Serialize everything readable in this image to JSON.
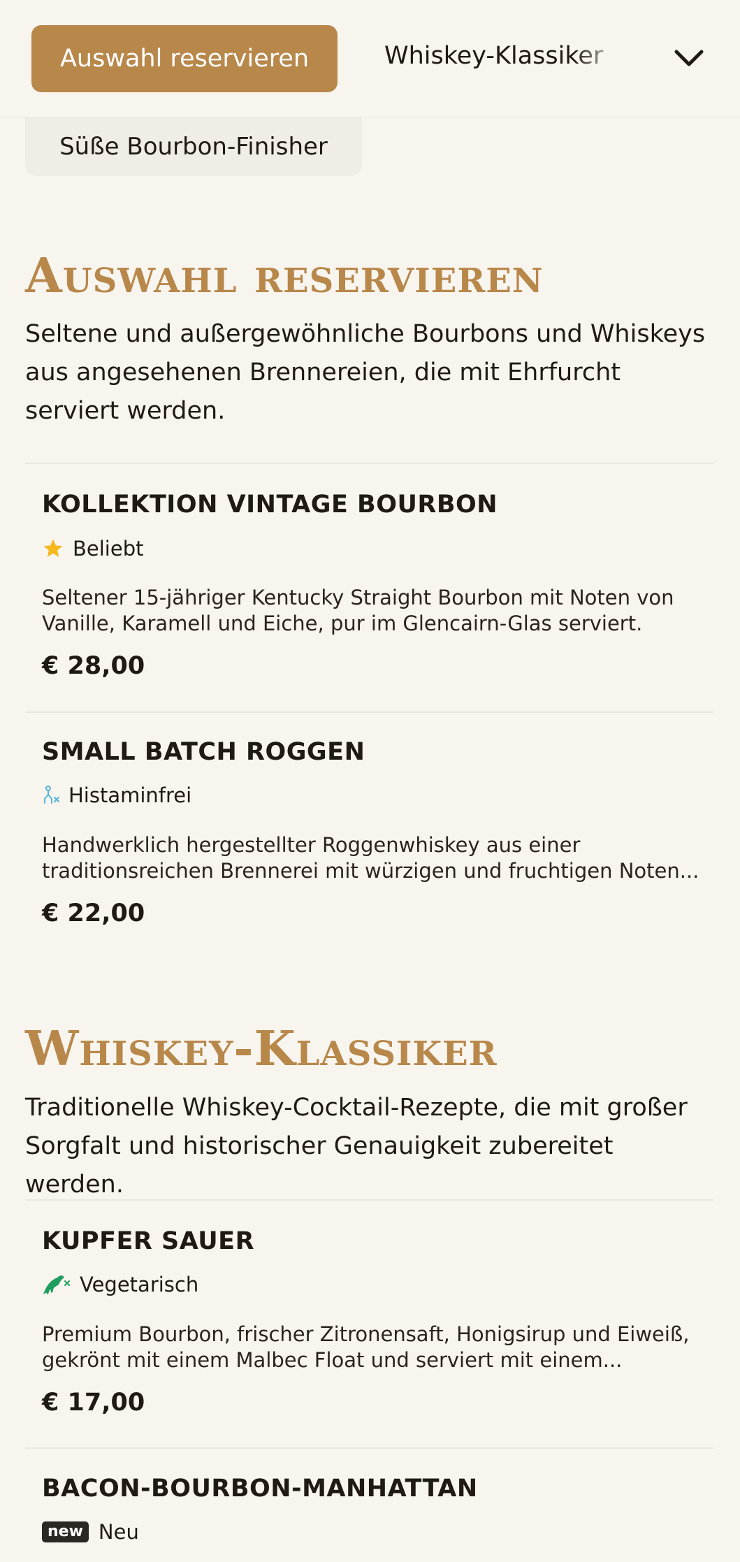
{
  "nav": {
    "active_tab": "Auswahl reservieren",
    "next_tab": "Whiskey-Klassiker",
    "previous_chip": "Süße Bourbon-Finisher",
    "dropdown_icon": "chevron-down-icon"
  },
  "sections": [
    {
      "title": "Auswahl reservieren",
      "description": "Seltene und außergewöhnliche Bourbons und Whiskeys aus angesehenen Brennereien, die mit Ehrfurcht serviert werden.",
      "items": [
        {
          "name": "KOLLEKTION VINTAGE BOURBON",
          "tag": "Beliebt",
          "tag_icon": "star-icon",
          "desc_line1": "Seltener 15-jähriger Kentucky Straight Bourbon mit Noten von",
          "desc_line2": "Vanille, Karamell und Eiche, pur im Glencairn-Glas serviert.",
          "price": "€ 28,00"
        },
        {
          "name": "SMALL BATCH ROGGEN",
          "tag": "Histaminfrei",
          "tag_icon": "histamine-free-icon",
          "desc_line1": "Handwerklich hergestellter Roggenwhiskey aus einer",
          "desc_line2": "traditionsreichen Brennerei mit würzigen und fruchtigen Noten...",
          "price": "€ 22,00"
        }
      ]
    },
    {
      "title": "Whiskey-Klassiker",
      "description": "Traditionelle Whiskey-Cocktail-Rezepte, die mit großer Sorgfalt und historischer Genauigkeit zubereitet werden.",
      "items": [
        {
          "name": "KUPFER SAUER",
          "tag": "Vegetarisch",
          "tag_icon": "vegetarian-icon",
          "desc_line1": "Premium Bourbon, frischer Zitronensaft, Honigsirup und Eiweiß,",
          "desc_line2": "gekrönt mit einem Malbec Float und serviert mit einem...",
          "price": "€ 17,00"
        },
        {
          "name": "BACON-BOURBON-MANHATTAN",
          "tag": "Neu",
          "tag_badge": "new",
          "tag_icon": "new-badge-icon"
        }
      ]
    }
  ],
  "colors": {
    "accent": "#b8874a",
    "background": "#f8f5ef",
    "star": "#f6b81c",
    "histamine": "#55b7d6",
    "vegetarian": "#1e9e5e"
  }
}
